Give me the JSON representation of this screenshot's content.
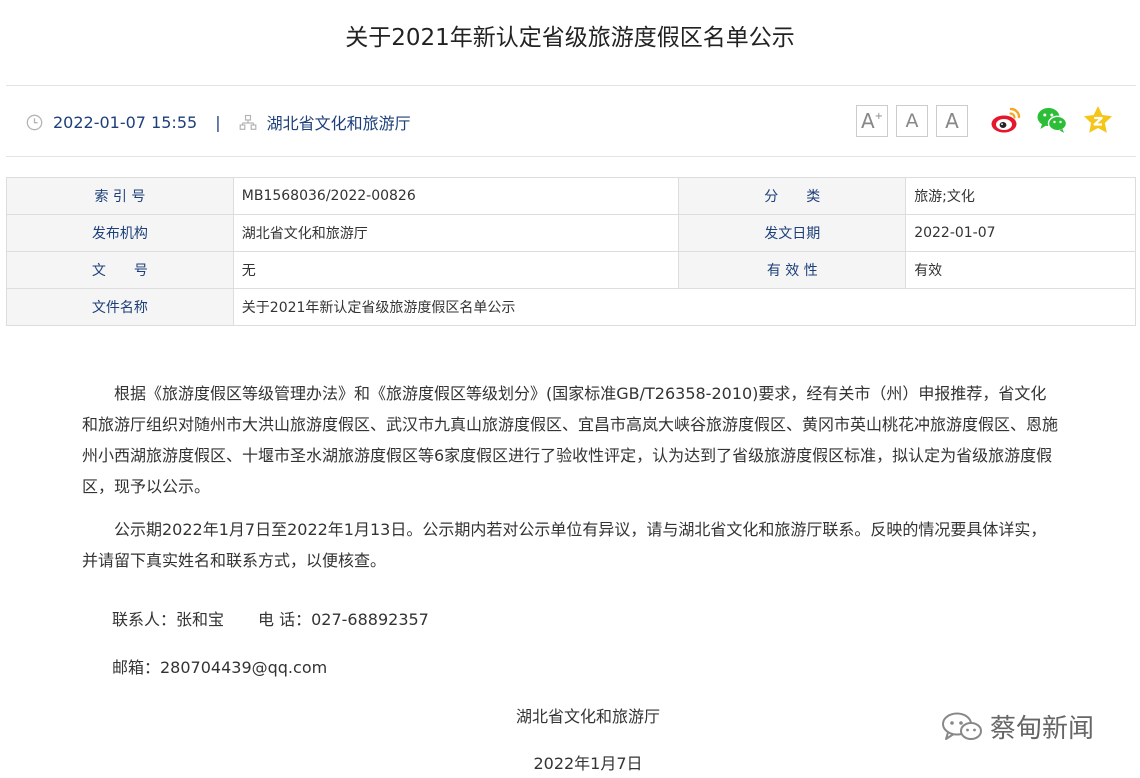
{
  "article": {
    "title": "关于2021年新认定省级旅游度假区名单公示",
    "date": "2022-01-07 15:55",
    "separator": "|",
    "publisher": "湖北省文化和旅游厅"
  },
  "font_controls": {
    "large": "A",
    "large_sup": "+",
    "medium": "A",
    "small": "A"
  },
  "share": {
    "icons": [
      "weibo-icon",
      "wechat-icon",
      "qzone-icon"
    ],
    "colors": {
      "weibo": "#e6162d",
      "weibo_ring": "#f5a623",
      "wechat": "#2dbe38",
      "qzone": "#f5c518"
    }
  },
  "info_table": {
    "index_label": "索 引 号",
    "index_value": "MB1568036/2022-00826",
    "category_label": "分　　类",
    "category_value": "旅游;文化",
    "org_label": "发布机构",
    "org_value": "湖北省文化和旅游厅",
    "pubdate_label": "发文日期",
    "pubdate_value": "2022-01-07",
    "docno_label": "文　　号",
    "docno_value": "无",
    "validity_label": "有 效 性",
    "validity_value": "有效",
    "docname_label": "文件名称",
    "docname_value": "关于2021年新认定省级旅游度假区名单公示"
  },
  "body": {
    "p1": "根据《旅游度假区等级管理办法》和《旅游度假区等级划分》(国家标准GB/T26358-2010)要求，经有关市（州）申报推荐，省文化和旅游厅组织对随州市大洪山旅游度假区、武汉市九真山旅游度假区、宜昌市高岚大峡谷旅游度假区、黄冈市英山桃花冲旅游度假区、恩施州小西湖旅游度假区、十堰市圣水湖旅游度假区等6家度假区进行了验收性评定，认为达到了省级旅游度假区标准，拟认定为省级旅游度假区，现予以公示。",
    "p2": "公示期2022年1月7日至2022年1月13日。公示期内若对公示单位有异议，请与湖北省文化和旅游厅联系。反映的情况要具体详实，并请留下真实姓名和联系方式，以便核查。",
    "contact": "联系人：张和宝",
    "phone": "电 话：027-68892357",
    "email": "邮箱：280704439@qq.com",
    "signature_org": "湖北省文化和旅游厅",
    "signature_date": "2022年1月7日"
  },
  "watermark": {
    "text": "蔡甸新闻"
  }
}
